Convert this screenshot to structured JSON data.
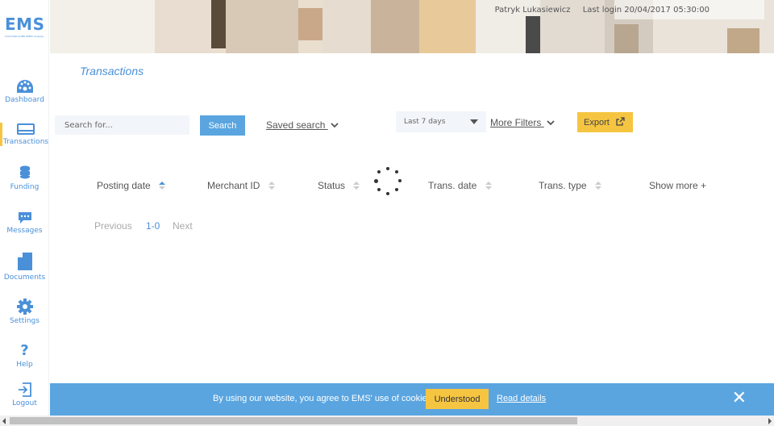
{
  "app": {
    "logo": "EMS",
    "logo_sub": "A First Data & ABN AMRO company"
  },
  "header": {
    "user_name": "Patryk Lukasiewicz",
    "last_login": "Last login 20/04/2017 05:30:00"
  },
  "sidebar": {
    "items": [
      {
        "label": "Dashboard",
        "icon": "gauge-icon"
      },
      {
        "label": "Transactions",
        "icon": "card-icon",
        "active": true
      },
      {
        "label": "Funding",
        "icon": "coins-icon"
      },
      {
        "label": "Messages",
        "icon": "chat-icon"
      },
      {
        "label": "Documents",
        "icon": "document-icon"
      },
      {
        "label": "Settings",
        "icon": "gear-icon"
      },
      {
        "label": "Help",
        "icon": "question-icon"
      },
      {
        "label": "Logout",
        "icon": "logout-icon"
      }
    ]
  },
  "page": {
    "title": "Transactions"
  },
  "filters": {
    "search_placeholder": "Search for...",
    "search_button": "Search",
    "saved_search": "Saved search",
    "date_range": "Last 7 days",
    "more_filters": "More Filters",
    "export": "Export"
  },
  "table": {
    "columns": [
      "Posting date",
      "Merchant ID",
      "Status",
      "Trans. date",
      "Trans. type"
    ],
    "show_more": "Show more +"
  },
  "pagination": {
    "previous": "Previous",
    "range": "1-0",
    "next": "Next"
  },
  "cookie": {
    "text": "By using our website, you agree to EMS' use of cookies.",
    "understood": "Understood",
    "read_details": "Read details"
  },
  "colors": {
    "accent": "#4a90d9",
    "button_blue": "#5aa5e0",
    "yellow": "#f5c542"
  }
}
